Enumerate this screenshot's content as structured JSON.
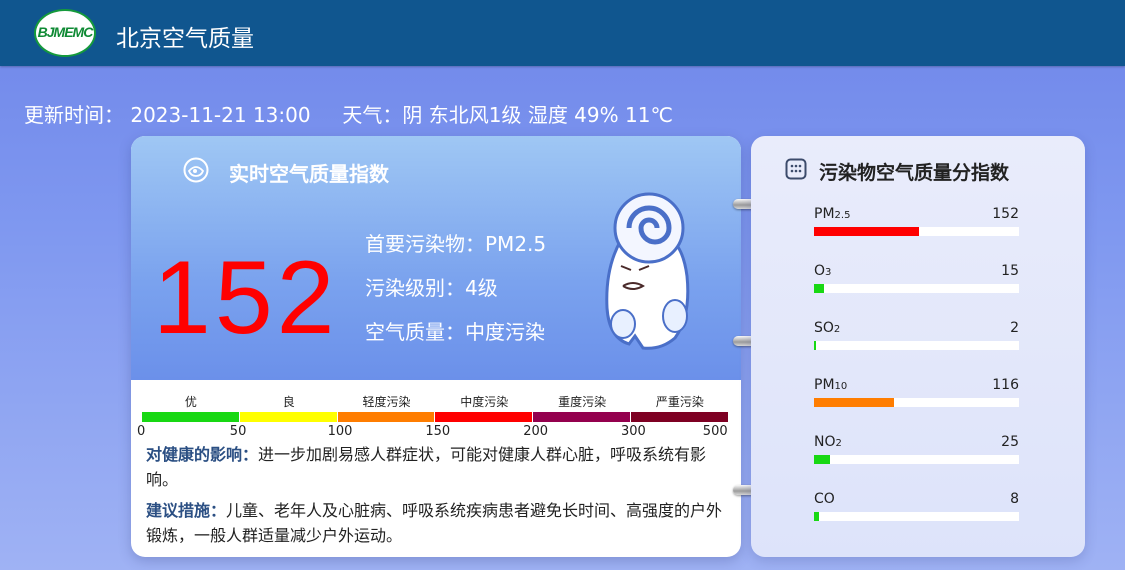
{
  "header": {
    "logo_text": "BJMEMC",
    "title": "北京空气质量"
  },
  "info": {
    "update_label": "更新时间：",
    "update_time": "2023-11-21 13:00",
    "weather": "天气：阴 东北风1级 湿度 49% 11℃"
  },
  "aqi": {
    "title": "实时空气质量指数",
    "value": "152",
    "primary_pollutant": "首要污染物：PM2.5",
    "level": "污染级别：4级",
    "quality": "空气质量：中度污染",
    "scale": [
      {
        "label": "优",
        "color": "#18d813"
      },
      {
        "label": "良",
        "color": "#ffff00"
      },
      {
        "label": "轻度污染",
        "color": "#ff7d00"
      },
      {
        "label": "中度污染",
        "color": "#ff0000"
      },
      {
        "label": "重度污染",
        "color": "#94004e"
      },
      {
        "label": "严重污染",
        "color": "#7e0023"
      }
    ],
    "ticks": [
      "0",
      "50",
      "100",
      "150",
      "200",
      "300",
      "500"
    ],
    "health_label": "对健康的影响：",
    "health_text": "进一步加剧易感人群症状，可能对健康人群心脏，呼吸系统有影响。",
    "advice_label": "建议措施：",
    "advice_text": "儿童、老年人及心脏病、呼吸系统疾病患者避免长时间、高强度的户外锻炼，一般人群适量减少户外运动。"
  },
  "pollutants": {
    "title": "污染物空气质量分指数",
    "items": [
      {
        "base": "PM",
        "sub": "2.5",
        "value": "152",
        "fill_fraction": 0.51,
        "color": "#ff0000"
      },
      {
        "base": "O",
        "sub": "3",
        "value": "15",
        "fill_fraction": 0.05,
        "color": "#18d813"
      },
      {
        "base": "SO",
        "sub": "2",
        "value": "2",
        "fill_fraction": 0.006,
        "color": "#18d813"
      },
      {
        "base": "PM",
        "sub": "10",
        "value": "116",
        "fill_fraction": 0.39,
        "color": "#ff7d00"
      },
      {
        "base": "NO",
        "sub": "2",
        "value": "25",
        "fill_fraction": 0.08,
        "color": "#18d813"
      },
      {
        "base": "CO",
        "sub": "",
        "value": "8",
        "fill_fraction": 0.026,
        "color": "#18d813"
      }
    ]
  }
}
